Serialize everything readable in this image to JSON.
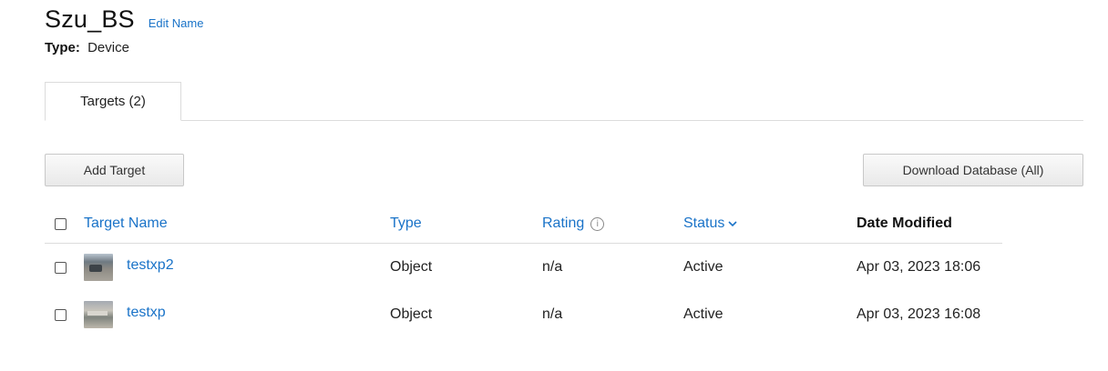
{
  "header": {
    "title": "Szu_BS",
    "edit_label": "Edit Name",
    "type_key": "Type:",
    "type_value": "Device"
  },
  "tabs": [
    {
      "label": "Targets (2)",
      "active": true
    }
  ],
  "toolbar": {
    "add_label": "Add Target",
    "download_label": "Download Database (All)"
  },
  "table": {
    "columns": {
      "name": "Target Name",
      "type": "Type",
      "rating": "Rating",
      "status": "Status",
      "date": "Date Modified"
    },
    "rows": [
      {
        "name": "testxp2",
        "type": "Object",
        "rating": "n/a",
        "status": "Active",
        "date": "Apr 03, 2023 18:06"
      },
      {
        "name": "testxp",
        "type": "Object",
        "rating": "n/a",
        "status": "Active",
        "date": "Apr 03, 2023 16:08"
      }
    ]
  },
  "icons": {
    "rating_info": "info-icon",
    "status_sort": "chevron-down-icon"
  },
  "colors": {
    "link": "#1a73c8",
    "border": "#dcdcdc"
  }
}
